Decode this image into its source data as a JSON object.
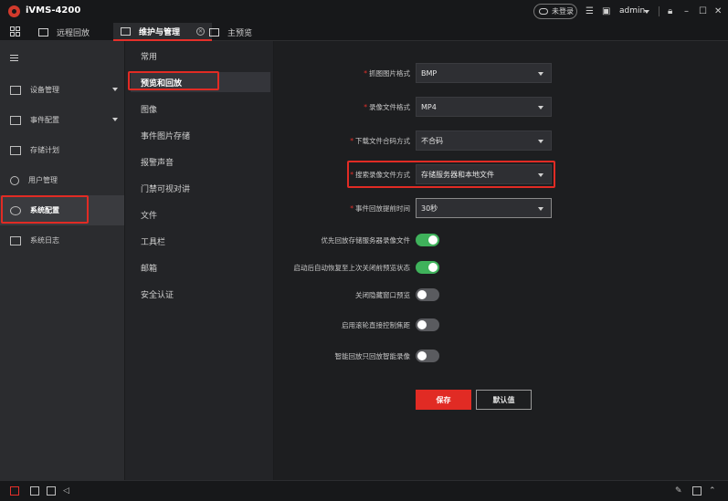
{
  "app": {
    "title": "iVMS-4200"
  },
  "titlebar": {
    "login_label": "未登录",
    "user": "admin"
  },
  "tabs": [
    {
      "label": "远程回放"
    },
    {
      "label": "维护与管理"
    },
    {
      "label": "主预览"
    }
  ],
  "leftnav": {
    "items": [
      {
        "label": "设备管理"
      },
      {
        "label": "事件配置"
      },
      {
        "label": "存储计划"
      },
      {
        "label": "用户管理"
      },
      {
        "label": "系统配置"
      },
      {
        "label": "系统日志"
      }
    ]
  },
  "subnav": {
    "items": [
      {
        "label": "常用"
      },
      {
        "label": "预览和回放"
      },
      {
        "label": "图像"
      },
      {
        "label": "事件图片存储"
      },
      {
        "label": "报警声音"
      },
      {
        "label": "门禁可视对讲"
      },
      {
        "label": "文件"
      },
      {
        "label": "工具栏"
      },
      {
        "label": "邮箱"
      },
      {
        "label": "安全认证"
      }
    ]
  },
  "form": {
    "selects": [
      {
        "label": "抓图图片格式",
        "value": "BMP"
      },
      {
        "label": "录像文件格式",
        "value": "MP4"
      },
      {
        "label": "下载文件合码方式",
        "value": "不合码"
      },
      {
        "label": "搜索录像文件方式",
        "value": "存储服务器和本地文件"
      },
      {
        "label": "事件回放提前时间",
        "value": "30秒"
      }
    ],
    "toggles": [
      {
        "label": "优先回放存储服务器录像文件",
        "on": true
      },
      {
        "label": "启动后自动恢复至上次关闭前预览状态",
        "on": true
      },
      {
        "label": "关闭隐藏窗口预览",
        "on": false
      },
      {
        "label": "启用滚轮直接控制焦距",
        "on": false
      },
      {
        "label": "智能回放只回放智能录像",
        "on": false
      }
    ],
    "save_label": "保存",
    "default_label": "默认值"
  },
  "colors": {
    "accent": "#e12b24",
    "toggle_on": "#3fb25b"
  }
}
